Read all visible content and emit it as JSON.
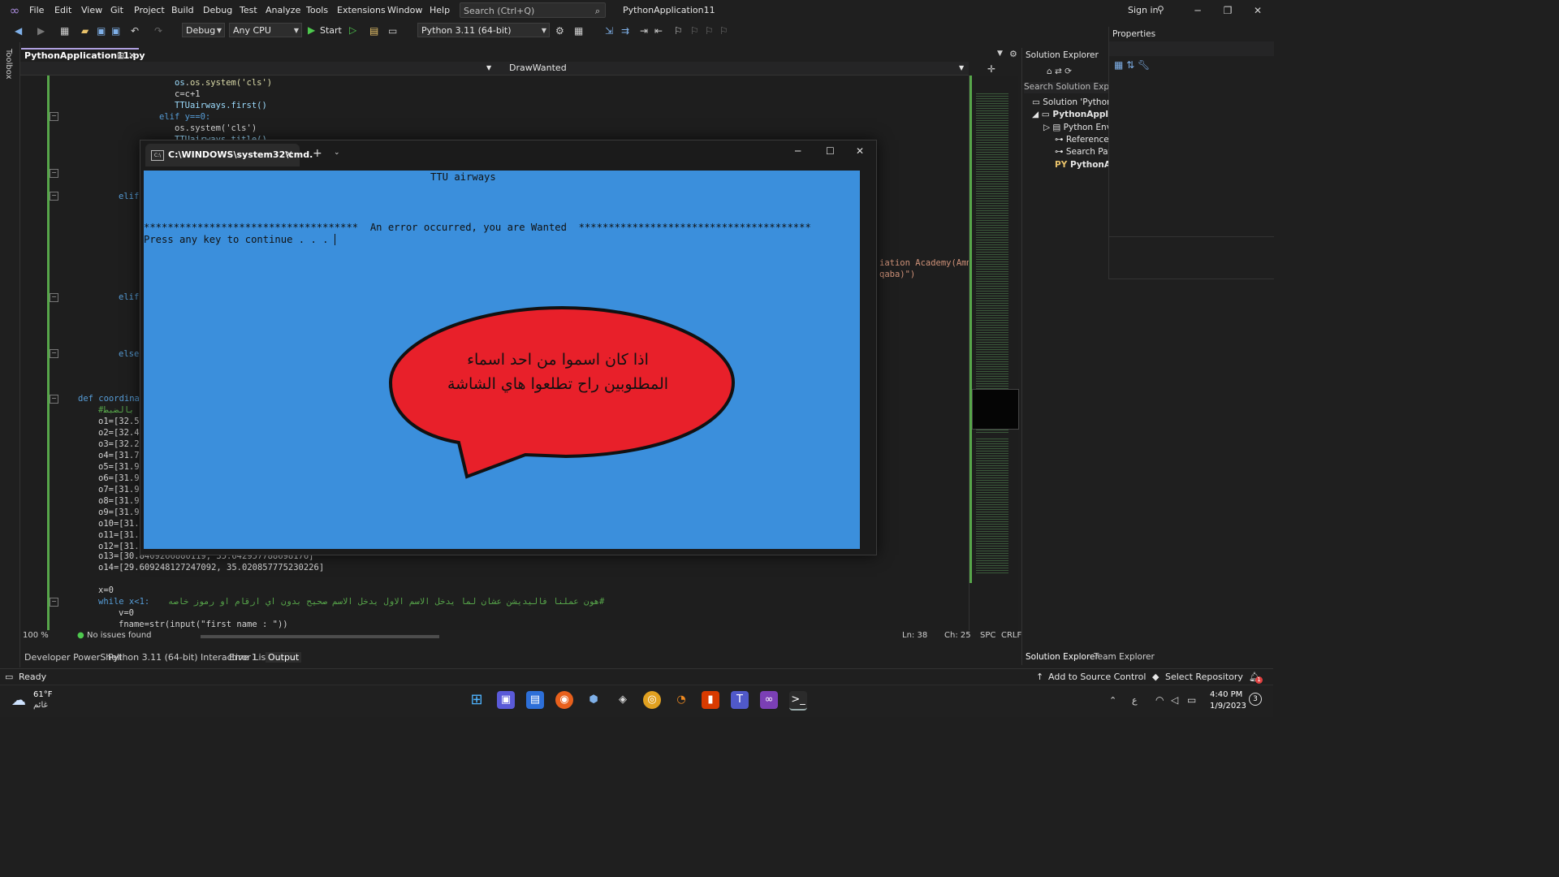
{
  "menu": [
    "File",
    "Edit",
    "View",
    "Git",
    "Project",
    "Build",
    "Debug",
    "Test",
    "Analyze",
    "Tools",
    "Extensions",
    "Window",
    "Help"
  ],
  "search_placeholder": "Search (Ctrl+Q)",
  "app_title": "PythonApplication11",
  "sign_in": "Sign in",
  "toolbar": {
    "config": "Debug",
    "platform": "Any CPU",
    "start": "Start",
    "environment": "Python 3.11 (64-bit)"
  },
  "toolbox_label": "Toolbox",
  "doc_tab": "PythonApplication11.py",
  "nav_member": "DrawWanted",
  "code_lines": {
    "l1": "os.system('cls')",
    "l2": "c=c+1",
    "l3": "TTUairways.first()",
    "l4": "elif y==0:",
    "l5": "os.system('cls')",
    "l6": "TTUairways.title()",
    "elif1": "elif",
    "elif2": "elif",
    "else1": "else",
    "defline": "def coordina",
    "comment1": "#بالضبط",
    "o1": "o1=[32.5",
    "o2": "o2=[32.4",
    "o3": "o3=[32.2",
    "o4": "o4=[31.7",
    "o5": "o5=[31.9",
    "o6": "o6=[31.9",
    "o7": "o7=[31.9",
    "o8": "o8=[31.9",
    "o9": "o9=[31.9",
    "o10": "o10=[31.",
    "o11": "o11=[31.",
    "o12": "o12=[31.",
    "o13": "o13=[30.8409266880119, 35.642957788698176]",
    "o14": "o14=[29.609248127247092, 35.020857775230226]",
    "x0": "x=0",
    "while": "while x<1:",
    "whilecomment": "#هون عملنا فاليديشن عشان لما يدخل الاسم الاول يدخل الاسم صحيح بدون اي ارقام او رموز خاصه",
    "v0": "v=0",
    "fname": "fname=str(input(\"first name : \"))",
    "right1": "iation Academy(Amm",
    "right2": "qaba)\")"
  },
  "editor_status": {
    "zoom": "100 %",
    "issues": "No issues found",
    "line": "Ln: 38",
    "col": "Ch: 25",
    "spc": "SPC",
    "crlf": "CRLF"
  },
  "bottom_tabs": [
    "Developer PowerShell",
    "Python 3.11 (64-bit) Interactive 1",
    "Error List",
    "Output"
  ],
  "solution_explorer": {
    "title": "Solution Explorer",
    "search": "Search Solution Explore",
    "items": [
      "Solution 'PythonA",
      "PythonApplica",
      "Python Env",
      "References",
      "Search Path",
      "PythonApp"
    ]
  },
  "properties_title": "Properties",
  "se_tabs": [
    "Solution Explorer",
    "Team Explorer"
  ],
  "status": {
    "ready": "Ready",
    "source_control": "Add to Source Control",
    "repo": "Select Repository",
    "notifications": "1"
  },
  "cmd": {
    "tab_title": "C:\\WINDOWS\\system32\\cmd.",
    "header": "TTU airways",
    "error_line": "************************************  An error occurred, you are Wanted  ***************************************",
    "press_key": "Press any key to continue . . .",
    "bubble_line1": "اذا كان اسموا من احد اسماء",
    "bubble_line2": "المطلوبين راح تطلعوا هاي الشاشة"
  },
  "taskbar": {
    "weather_temp": "61°F",
    "weather_desc": "غائم",
    "time": "4:40 PM",
    "date": "1/9/2023",
    "lang": "ع",
    "badge": "3"
  },
  "colors": {
    "console_bg": "#3b8fdc",
    "bubble_fill": "#e8202a",
    "accent": "#a98bdc"
  }
}
